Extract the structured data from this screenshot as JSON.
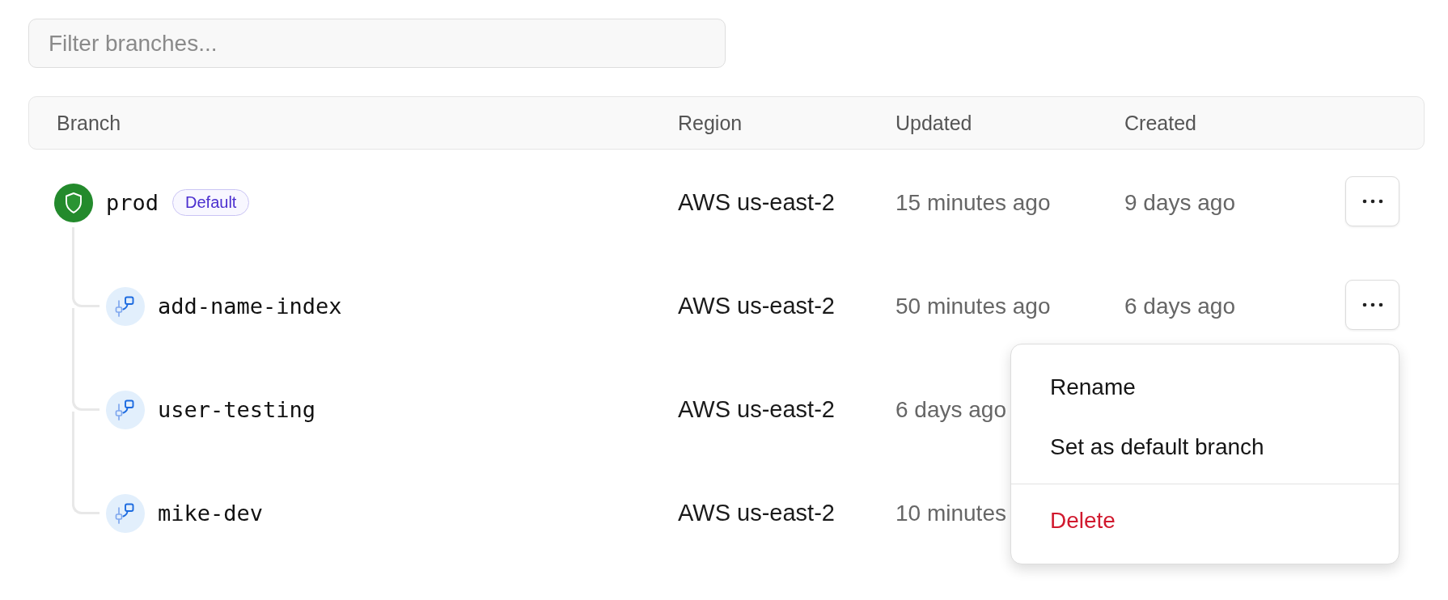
{
  "filter": {
    "placeholder": "Filter branches..."
  },
  "table": {
    "columns": [
      "Branch",
      "Region",
      "Updated",
      "Created"
    ],
    "rows": [
      {
        "name": "prod",
        "kind": "protected",
        "badge": "Default",
        "region": "AWS us-east-2",
        "updated": "15 minutes ago",
        "created": "9 days ago",
        "more_button": true,
        "children": [
          {
            "name": "add-name-index",
            "kind": "branch",
            "region": "AWS us-east-2",
            "updated": "50 minutes ago",
            "created": "6 days ago",
            "more_button": true,
            "menu": {
              "groups": [
                {
                  "items": [
                    {
                      "label": "Rename",
                      "kind": "default"
                    },
                    {
                      "label": "Set as default branch",
                      "kind": "default"
                    }
                  ]
                },
                {
                  "items": [
                    {
                      "label": "Delete",
                      "kind": "danger"
                    }
                  ]
                }
              ]
            }
          },
          {
            "name": "user-testing",
            "kind": "branch",
            "region": "AWS us-east-2",
            "updated": "6 days ago"
          },
          {
            "name": "mike-dev",
            "kind": "branch",
            "region": "AWS us-east-2",
            "updated": "10 minutes"
          }
        ]
      }
    ]
  }
}
